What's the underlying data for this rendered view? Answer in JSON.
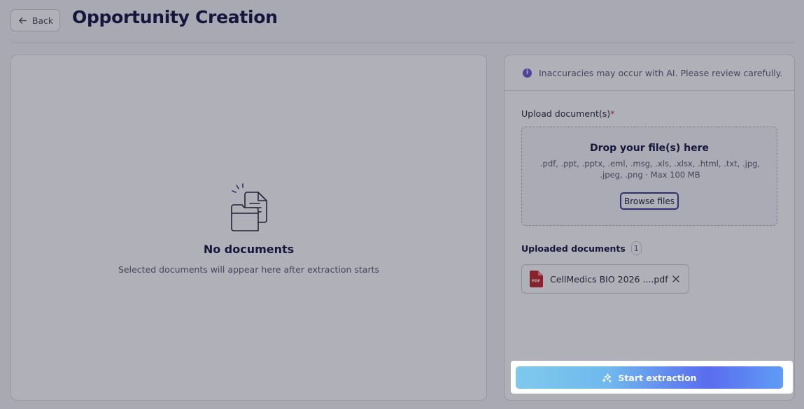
{
  "header": {
    "back_label": "Back",
    "title": "Opportunity Creation"
  },
  "left_panel": {
    "empty_title": "No documents",
    "empty_subtitle": "Selected documents will appear here after extraction starts",
    "illustration_icon": "documents-folder-icon"
  },
  "right_panel": {
    "notice": "Inaccuracies may occur with AI. Please review carefully.",
    "upload_label": "Upload document(s)",
    "required_marker": "*",
    "dropzone": {
      "title": "Drop your file(s) here",
      "formats": ".pdf, .ppt, .pptx, .eml, .msg, .xls, .xlsx, .html, .txt, .jpg, .jpeg, .png · Max 100 MB",
      "browse_label": "Browse files"
    },
    "uploaded_heading": "Uploaded documents",
    "uploaded_count": "1",
    "files": [
      {
        "name": "CellMedics BIO 2026 ....pdf",
        "type_label": "PDF"
      }
    ]
  },
  "footer": {
    "start_label": "Start extraction"
  },
  "colors": {
    "title": "#161643",
    "accent_purple": "#6b5bd6",
    "pdf_red": "#c6282b",
    "required": "#d83a3a",
    "overlay": "rgba(24,24,50,0.34)"
  }
}
